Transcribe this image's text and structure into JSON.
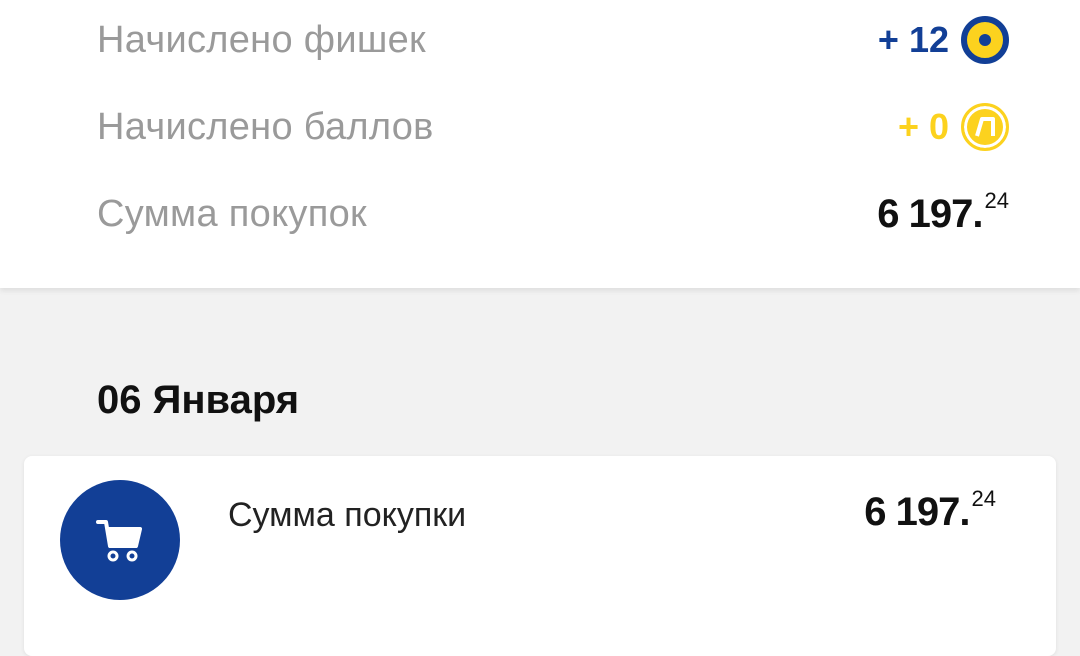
{
  "summary": {
    "chips": {
      "label": "Начислено фишек",
      "value": "+ 12"
    },
    "points": {
      "label": "Начислено баллов",
      "value": "+ 0"
    },
    "total": {
      "label": "Сумма покупок",
      "main": "6 197.",
      "cents": "24"
    }
  },
  "day_group": {
    "date": "06 Января",
    "purchase": {
      "label": "Сумма покупки",
      "main": "6 197.",
      "cents": "24",
      "icon": "cart-icon"
    }
  },
  "colors": {
    "brand_blue": "#123f96",
    "brand_yellow": "#fcd21e",
    "label_gray": "#9a9a9a",
    "background": "#f2f2f2"
  }
}
